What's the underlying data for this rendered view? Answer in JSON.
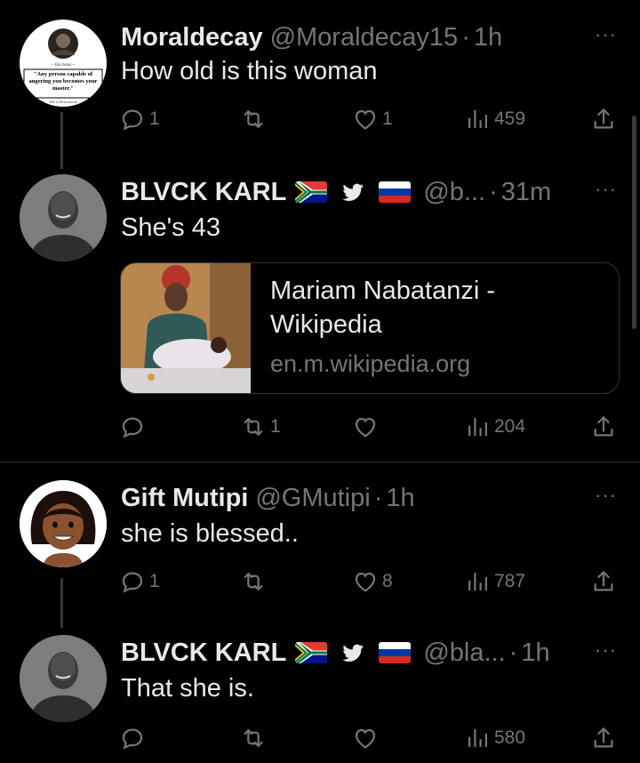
{
  "tweets": [
    {
      "name": "Moraldecay",
      "handle": "@Moraldecay15",
      "time": "1h",
      "text": "How old is this woman",
      "avatar_text": {
        "caption": "~ Epictetus ~",
        "quote": "\"Any person capable of angering you becomes your master.\"",
        "footer": "Talk is Motivational"
      },
      "replies": "1",
      "retweets": "",
      "likes": "1",
      "views": "459"
    },
    {
      "name": "BLVCK KARL",
      "handle": "@b...",
      "time": "31m",
      "text": "She's 43",
      "card": {
        "title": "Mariam Nabatanzi - Wikipedia",
        "domain": "en.m.wikipedia.org"
      },
      "replies": "",
      "retweets": "1",
      "likes": "",
      "views": "204"
    },
    {
      "name": "Gift Mutipi",
      "handle": "@GMutipi",
      "time": "1h",
      "text": "she is blessed..",
      "replies": "1",
      "retweets": "",
      "likes": "8",
      "views": "787"
    },
    {
      "name": "BLVCK KARL",
      "handle": "@bla...",
      "time": "1h",
      "text": "That she is.",
      "replies": "",
      "retweets": "",
      "likes": "",
      "views": "580"
    }
  ],
  "separator": "·",
  "more_label": "···",
  "icons": {
    "reply": "reply-icon",
    "retweet": "retweet-icon",
    "like": "heart-icon",
    "views": "views-icon",
    "share": "share-icon",
    "badges": [
      "south-africa-flag-icon",
      "twitter-bird-icon",
      "russia-flag-icon"
    ]
  },
  "colors": {
    "background": "#000000",
    "primary_text": "#e7e9ea",
    "secondary_text": "#71767b",
    "divider": "#2f3336"
  }
}
